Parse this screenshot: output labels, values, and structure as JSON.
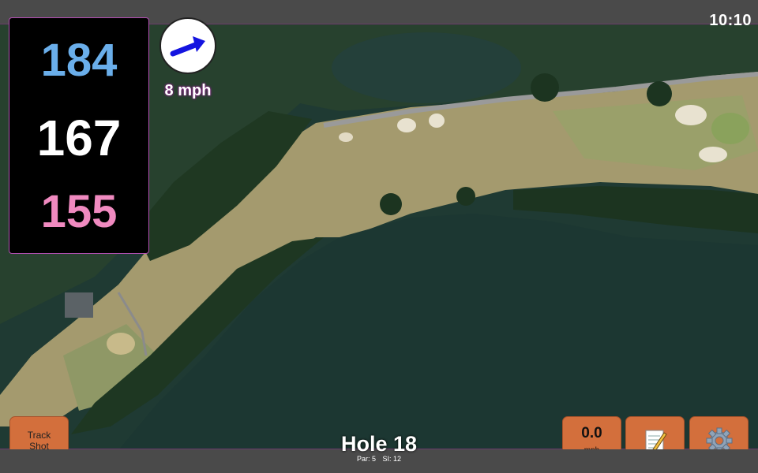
{
  "status": {
    "time": "10:10"
  },
  "yardages": {
    "back": "184",
    "middle": "167",
    "front": "155"
  },
  "wind": {
    "speed_label": "8 mph",
    "direction_icon": "arrow-icon"
  },
  "buttons": {
    "track_shot": {
      "line1": "Track",
      "line2": "Shot"
    },
    "speed": {
      "value": "0.0",
      "unit": "mph"
    },
    "notes_icon": "notepad-icon",
    "settings_icon": "gear-icon"
  },
  "hole": {
    "title": "Hole 18",
    "par": "Par: 5",
    "si": "SI: 12"
  },
  "colors": {
    "back_yardage": "#6aaeea",
    "middle_yardage": "#ffffff",
    "front_yardage": "#f08ac0",
    "button": "#d36f3c",
    "panel_border": "#b44fb4"
  }
}
